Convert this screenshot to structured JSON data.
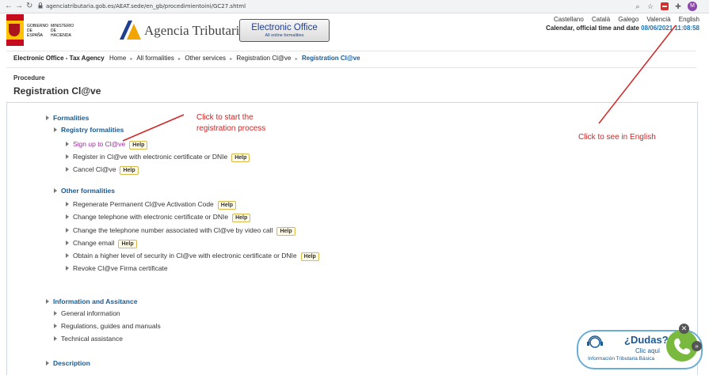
{
  "browser": {
    "url": "agenciatributaria.gob.es/AEAT.sede/en_gb/procedimientoini/GC27.shtml",
    "profile_initial": "M"
  },
  "header": {
    "gov_text_1": "GOBIERNO DE ESPAÑA",
    "gov_text_2": "MINISTERIO DE HACIENDA",
    "agency_name": "Agencia Tributaria",
    "eo_title": "Electronic Office",
    "eo_subtitle": "All online formalities",
    "languages": [
      "Castellano",
      "Català",
      "Galego",
      "Valencià",
      "English"
    ],
    "calendar_label": "Calendar, official time and date",
    "calendar_value": "08/06/2021 11:08:58"
  },
  "breadcrumb": {
    "site": "Electronic Office - Tax Agency",
    "items": [
      "Home",
      "All formalities",
      "Other services",
      "Registration Cl@ve"
    ],
    "current": "Registration Cl@ve"
  },
  "page": {
    "procedure_label": "Procedure",
    "title": "Registration Cl@ve"
  },
  "tree": {
    "formalities": "Formalities",
    "registry_formalities": "Registry formalities",
    "registry_items": [
      {
        "label": "Sign up to Cl@ve",
        "help": "Help"
      },
      {
        "label": "Register in Cl@ve with electronic certificate or DNIe",
        "help": "Help"
      },
      {
        "label": "Cancel Cl@ve",
        "help": "Help"
      }
    ],
    "other_formalities": "Other formalities",
    "other_items": [
      {
        "label": "Regenerate Permanent Cl@ve Activation Code",
        "help": "Help"
      },
      {
        "label": "Change telephone with electronic certificate or DNIe",
        "help": "Help"
      },
      {
        "label": "Change the telephone number associated with Cl@ve by video call",
        "help": "Help"
      },
      {
        "label": "Change email",
        "help": "Help"
      },
      {
        "label": "Obtain a higher level of security in Cl@ve with electronic certificate or DNIe",
        "help": "Help"
      },
      {
        "label": "Revoke Cl@ve Firma certificate",
        "help": ""
      }
    ],
    "info_assistance": "Information and Assitance",
    "info_items": [
      "General information",
      "Regulations, guides and manuals",
      "Technical assistance"
    ],
    "description": "Description"
  },
  "annotations": {
    "registration_note_line1": "Click to start the",
    "registration_note_line2": "registration process",
    "english_note": "Click to see in English",
    "color": "#d32525"
  },
  "chat_widget": {
    "question": "¿Dudas?",
    "click": "Clic aquí",
    "info": "Información Tributaria Básica",
    "close": "✕",
    "next": "»"
  },
  "colors": {
    "link_blue": "#1a5a94",
    "visited_purple": "#9b2d9e",
    "phone_green": "#7ab93f"
  }
}
